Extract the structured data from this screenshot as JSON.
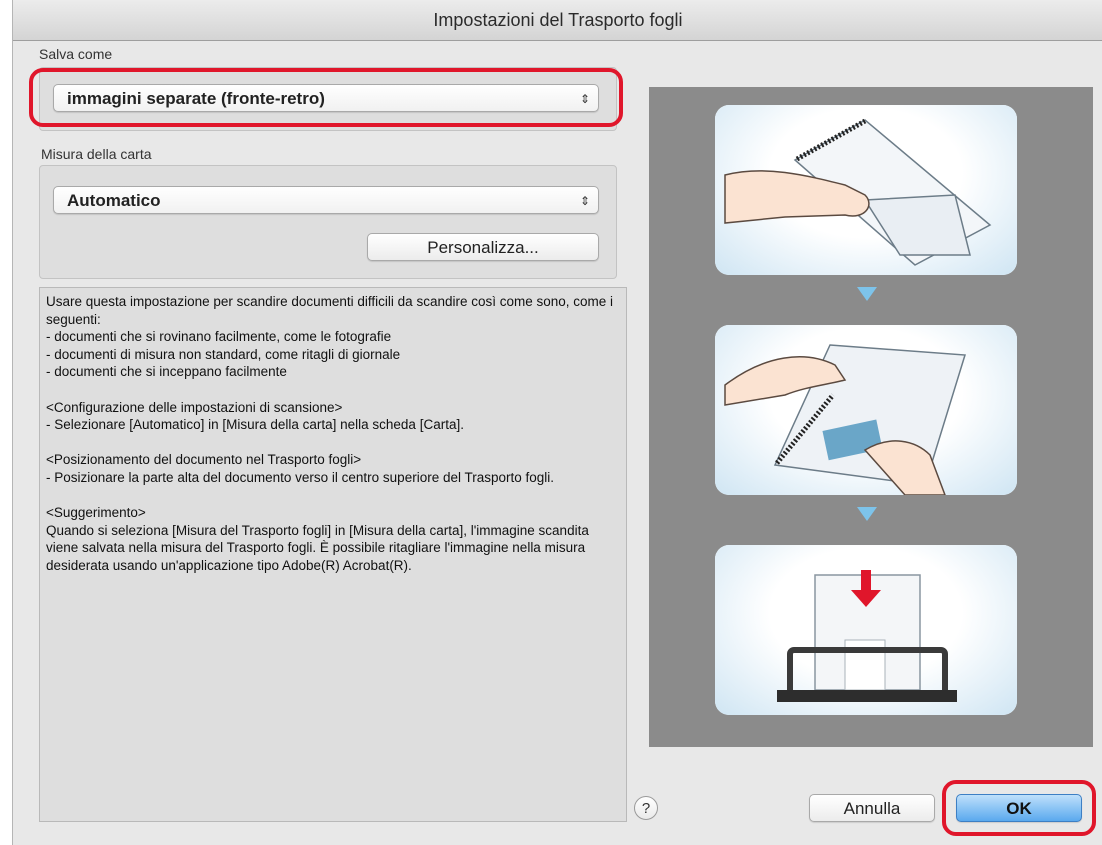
{
  "window": {
    "title": "Impostazioni del Trasporto fogli"
  },
  "save_as": {
    "label": "Salva come",
    "selected": "immagini separate (fronte-retro)",
    "arrows": "⇕"
  },
  "paper_size": {
    "label": "Misura della carta",
    "selected": "Automatico",
    "arrows": "⇕",
    "customize_label": "Personalizza..."
  },
  "description": "Usare questa impostazione per scandire documenti difficili da scandire così come sono, come i seguenti:\n- documenti che si rovinano facilmente, come le fotografie\n- documenti di misura non standard, come ritagli di giornale\n- documenti che si inceppano facilmente\n\n<Configurazione delle impostazioni di scansione>\n- Selezionare [Automatico] in [Misura della carta] nella scheda [Carta].\n\n<Posizionamento del documento nel Trasporto fogli>\n- Posizionare la parte alta del documento verso il centro superiore del Trasporto fogli.\n\n<Suggerimento>\nQuando si seleziona [Misura del Trasporto fogli] in [Misura della carta], l'immagine scandita viene salvata nella misura del Trasporto fogli. È possibile ritagliare l'immagine nella misura desiderata usando un'applicazione tipo Adobe(R) Acrobat(R).",
  "buttons": {
    "help": "?",
    "cancel": "Annulla",
    "ok": "OK"
  },
  "colors": {
    "highlight": "#e0162b",
    "ok_button": "#5aa9ee",
    "illustration_bg": "#8b8b8b",
    "step_arrow": "#7dc3ea"
  }
}
